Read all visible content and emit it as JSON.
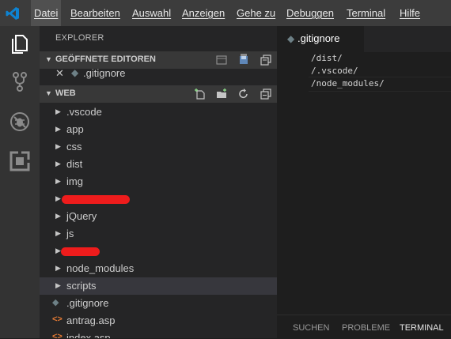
{
  "menubar": {
    "items": [
      {
        "label": "Datei"
      },
      {
        "label": "Bearbeiten"
      },
      {
        "label": "Auswahl"
      },
      {
        "label": "Anzeigen"
      },
      {
        "label": "Gehe zu"
      },
      {
        "label": "Debuggen"
      },
      {
        "label": "Terminal"
      },
      {
        "label": "Hilfe"
      }
    ],
    "logo_icon": "vscode-logo-icon",
    "accent": "#0078d4"
  },
  "activitybar": {
    "icons": [
      "explorer-icon",
      "source-control-icon",
      "debug-icon",
      "extensions-icon"
    ]
  },
  "sidebar": {
    "title": "EXPLORER",
    "open_editors": {
      "title": "GEÖFFNETE EDITOREN",
      "items": [
        {
          "label": ".gitignore"
        }
      ]
    },
    "folder": {
      "title": "WEB",
      "items": [
        {
          "label": ".vscode",
          "type": "folder"
        },
        {
          "label": "app",
          "type": "folder"
        },
        {
          "label": "css",
          "type": "folder"
        },
        {
          "label": "dist",
          "type": "folder"
        },
        {
          "label": "img",
          "type": "folder"
        },
        {
          "label": "",
          "type": "folder",
          "redacted": true
        },
        {
          "label": "jQuery",
          "type": "folder"
        },
        {
          "label": "js",
          "type": "folder"
        },
        {
          "label": "",
          "type": "folder",
          "redacted": true
        },
        {
          "label": "node_modules",
          "type": "folder"
        },
        {
          "label": "scripts",
          "type": "folder",
          "selected": true
        },
        {
          "label": ".gitignore",
          "type": "file"
        },
        {
          "label": "antrag.asp",
          "type": "file"
        },
        {
          "label": "index.asp",
          "type": "file"
        }
      ]
    }
  },
  "editor": {
    "tab": {
      "label": ".gitignore"
    },
    "lines": [
      "/dist/",
      "/.vscode/",
      "/node_modules/"
    ]
  },
  "panel": {
    "tabs": [
      {
        "label": "SUCHEN"
      },
      {
        "label": "PROBLEME"
      },
      {
        "label": "TERMINAL",
        "active": true
      }
    ]
  }
}
